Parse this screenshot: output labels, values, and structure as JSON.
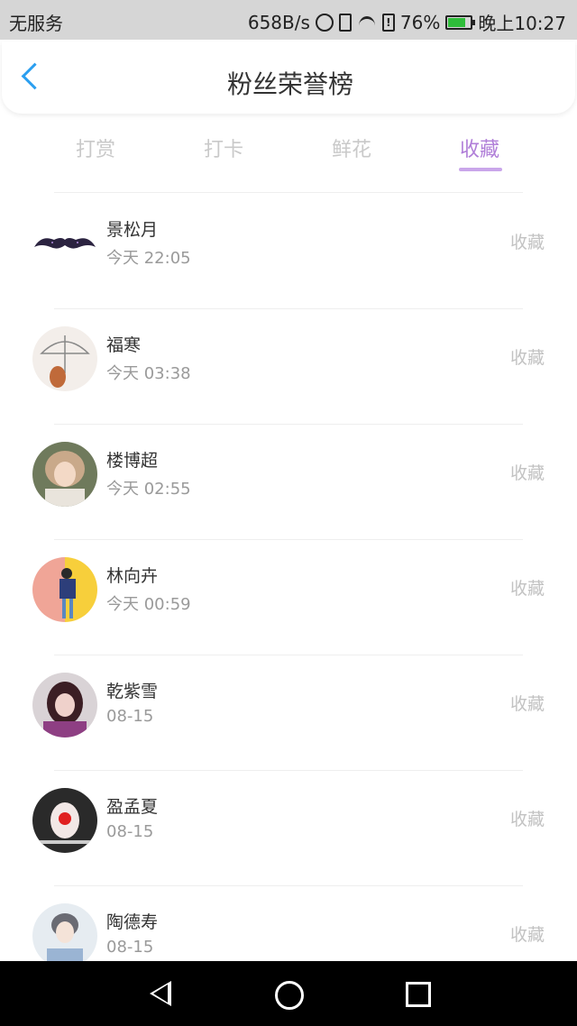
{
  "status": {
    "carrier": "无服务",
    "speed": "658B/s",
    "battery": "76%",
    "battery_level": 0.76,
    "time": "晚上10:27"
  },
  "header": {
    "title": "粉丝荣誉榜"
  },
  "tabs": [
    {
      "label": "打赏"
    },
    {
      "label": "打卡"
    },
    {
      "label": "鲜花"
    },
    {
      "label": "收藏"
    }
  ],
  "active_tab": 3,
  "colors": {
    "accent": "#b07ed8",
    "back": "#2b9ff0"
  },
  "list": [
    {
      "name": "景松月",
      "time": "今天 22:05",
      "action": "收藏",
      "avatar": "mustache-avatar"
    },
    {
      "name": "福寒",
      "time": "今天 03:38",
      "action": "收藏",
      "avatar": "umbrella-avatar"
    },
    {
      "name": "楼博超",
      "time": "今天 02:55",
      "action": "收藏",
      "avatar": "girl-avatar"
    },
    {
      "name": "林向卉",
      "time": "今天 00:59",
      "action": "收藏",
      "avatar": "yellow-avatar"
    },
    {
      "name": "乾紫雪",
      "time": "08-15",
      "action": "收藏",
      "avatar": "pink-avatar"
    },
    {
      "name": "盈孟夏",
      "time": "08-15",
      "action": "收藏",
      "avatar": "clown-avatar"
    },
    {
      "name": "陶德寿",
      "time": "08-15",
      "action": "收藏",
      "avatar": "boy-avatar"
    }
  ]
}
